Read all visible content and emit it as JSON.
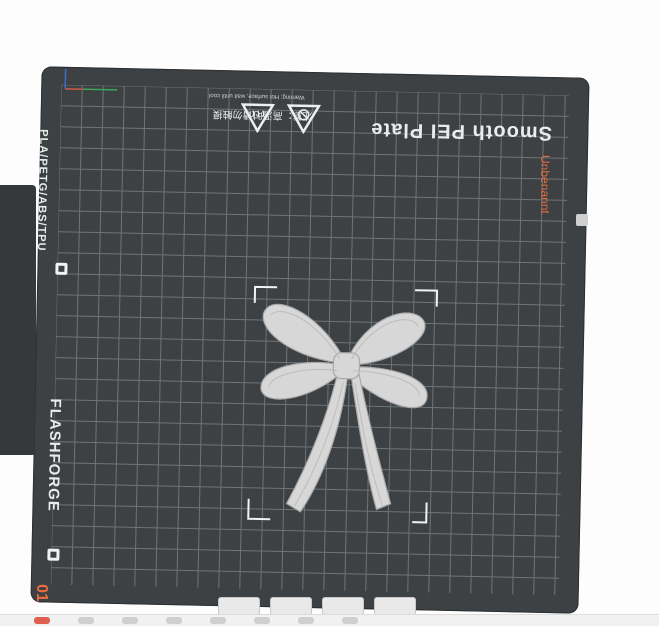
{
  "build_plate": {
    "title": "Smooth PEI Plate",
    "warning_cn": "注意：高温时请勿触摸",
    "warning_en": "Warning: Hot surface, wait until cool",
    "materials": "PLA/PETG/ABS/TPU",
    "brand": "FLASHFORGE"
  },
  "side_label": "Unbenannt",
  "bottom_number": "01",
  "colors": {
    "plate": "#3d4143",
    "grid": "#6a6f71",
    "accent": "#e56a3d",
    "model": "#d6d6d6"
  },
  "icons": {
    "hazard_heat": "hot-surface-warning-icon",
    "hazard_hand": "no-touch-warning-icon",
    "axis": "axis-origin-icon"
  }
}
